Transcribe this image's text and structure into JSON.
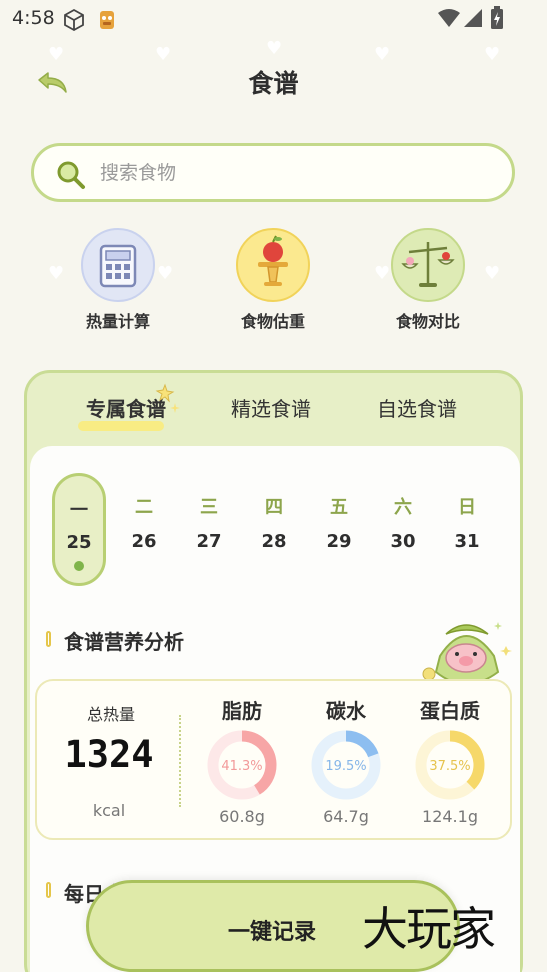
{
  "status": {
    "time": "4:58"
  },
  "header": {
    "title": "食谱"
  },
  "search": {
    "placeholder": "搜索食物"
  },
  "tools": [
    {
      "label": "热量计算",
      "icon": "calculator-icon"
    },
    {
      "label": "食物估重",
      "icon": "apple-scale-icon"
    },
    {
      "label": "食物对比",
      "icon": "balance-scale-icon"
    }
  ],
  "tabs": [
    {
      "label": "专属食谱",
      "active": true
    },
    {
      "label": "精选食谱",
      "active": false
    },
    {
      "label": "自选食谱",
      "active": false
    }
  ],
  "week": [
    {
      "weekday": "一",
      "date": "25",
      "selected": true
    },
    {
      "weekday": "二",
      "date": "26"
    },
    {
      "weekday": "三",
      "date": "27"
    },
    {
      "weekday": "四",
      "date": "28"
    },
    {
      "weekday": "五",
      "date": "29"
    },
    {
      "weekday": "六",
      "date": "30"
    },
    {
      "weekday": "日",
      "date": "31"
    }
  ],
  "analysis": {
    "title": "食谱营养分析",
    "total_label": "总热量",
    "total_value": "1324",
    "total_unit": "kcal",
    "nutrients": [
      {
        "name": "脂肪",
        "percent": 41.3,
        "percent_text": "41.3%",
        "grams": "60.8g",
        "color": "#f7a6a6",
        "track": "#fde8e8",
        "text_color": "#f29a9a"
      },
      {
        "name": "碳水",
        "percent": 19.5,
        "percent_text": "19.5%",
        "grams": "64.7g",
        "color": "#8dbef0",
        "track": "#e5f1fb",
        "text_color": "#86b6e8"
      },
      {
        "name": "蛋白质",
        "percent": 37.5,
        "percent_text": "37.5%",
        "grams": "124.1g",
        "color": "#f6d86a",
        "track": "#fdf5d6",
        "text_color": "#e6c34e"
      }
    ]
  },
  "daily": {
    "title": "每日食"
  },
  "bottom": {
    "record_label": "一键记录",
    "watermark": "大玩家"
  },
  "colors": {
    "accent": "#c4d98a",
    "background": "#f7f6ee"
  }
}
